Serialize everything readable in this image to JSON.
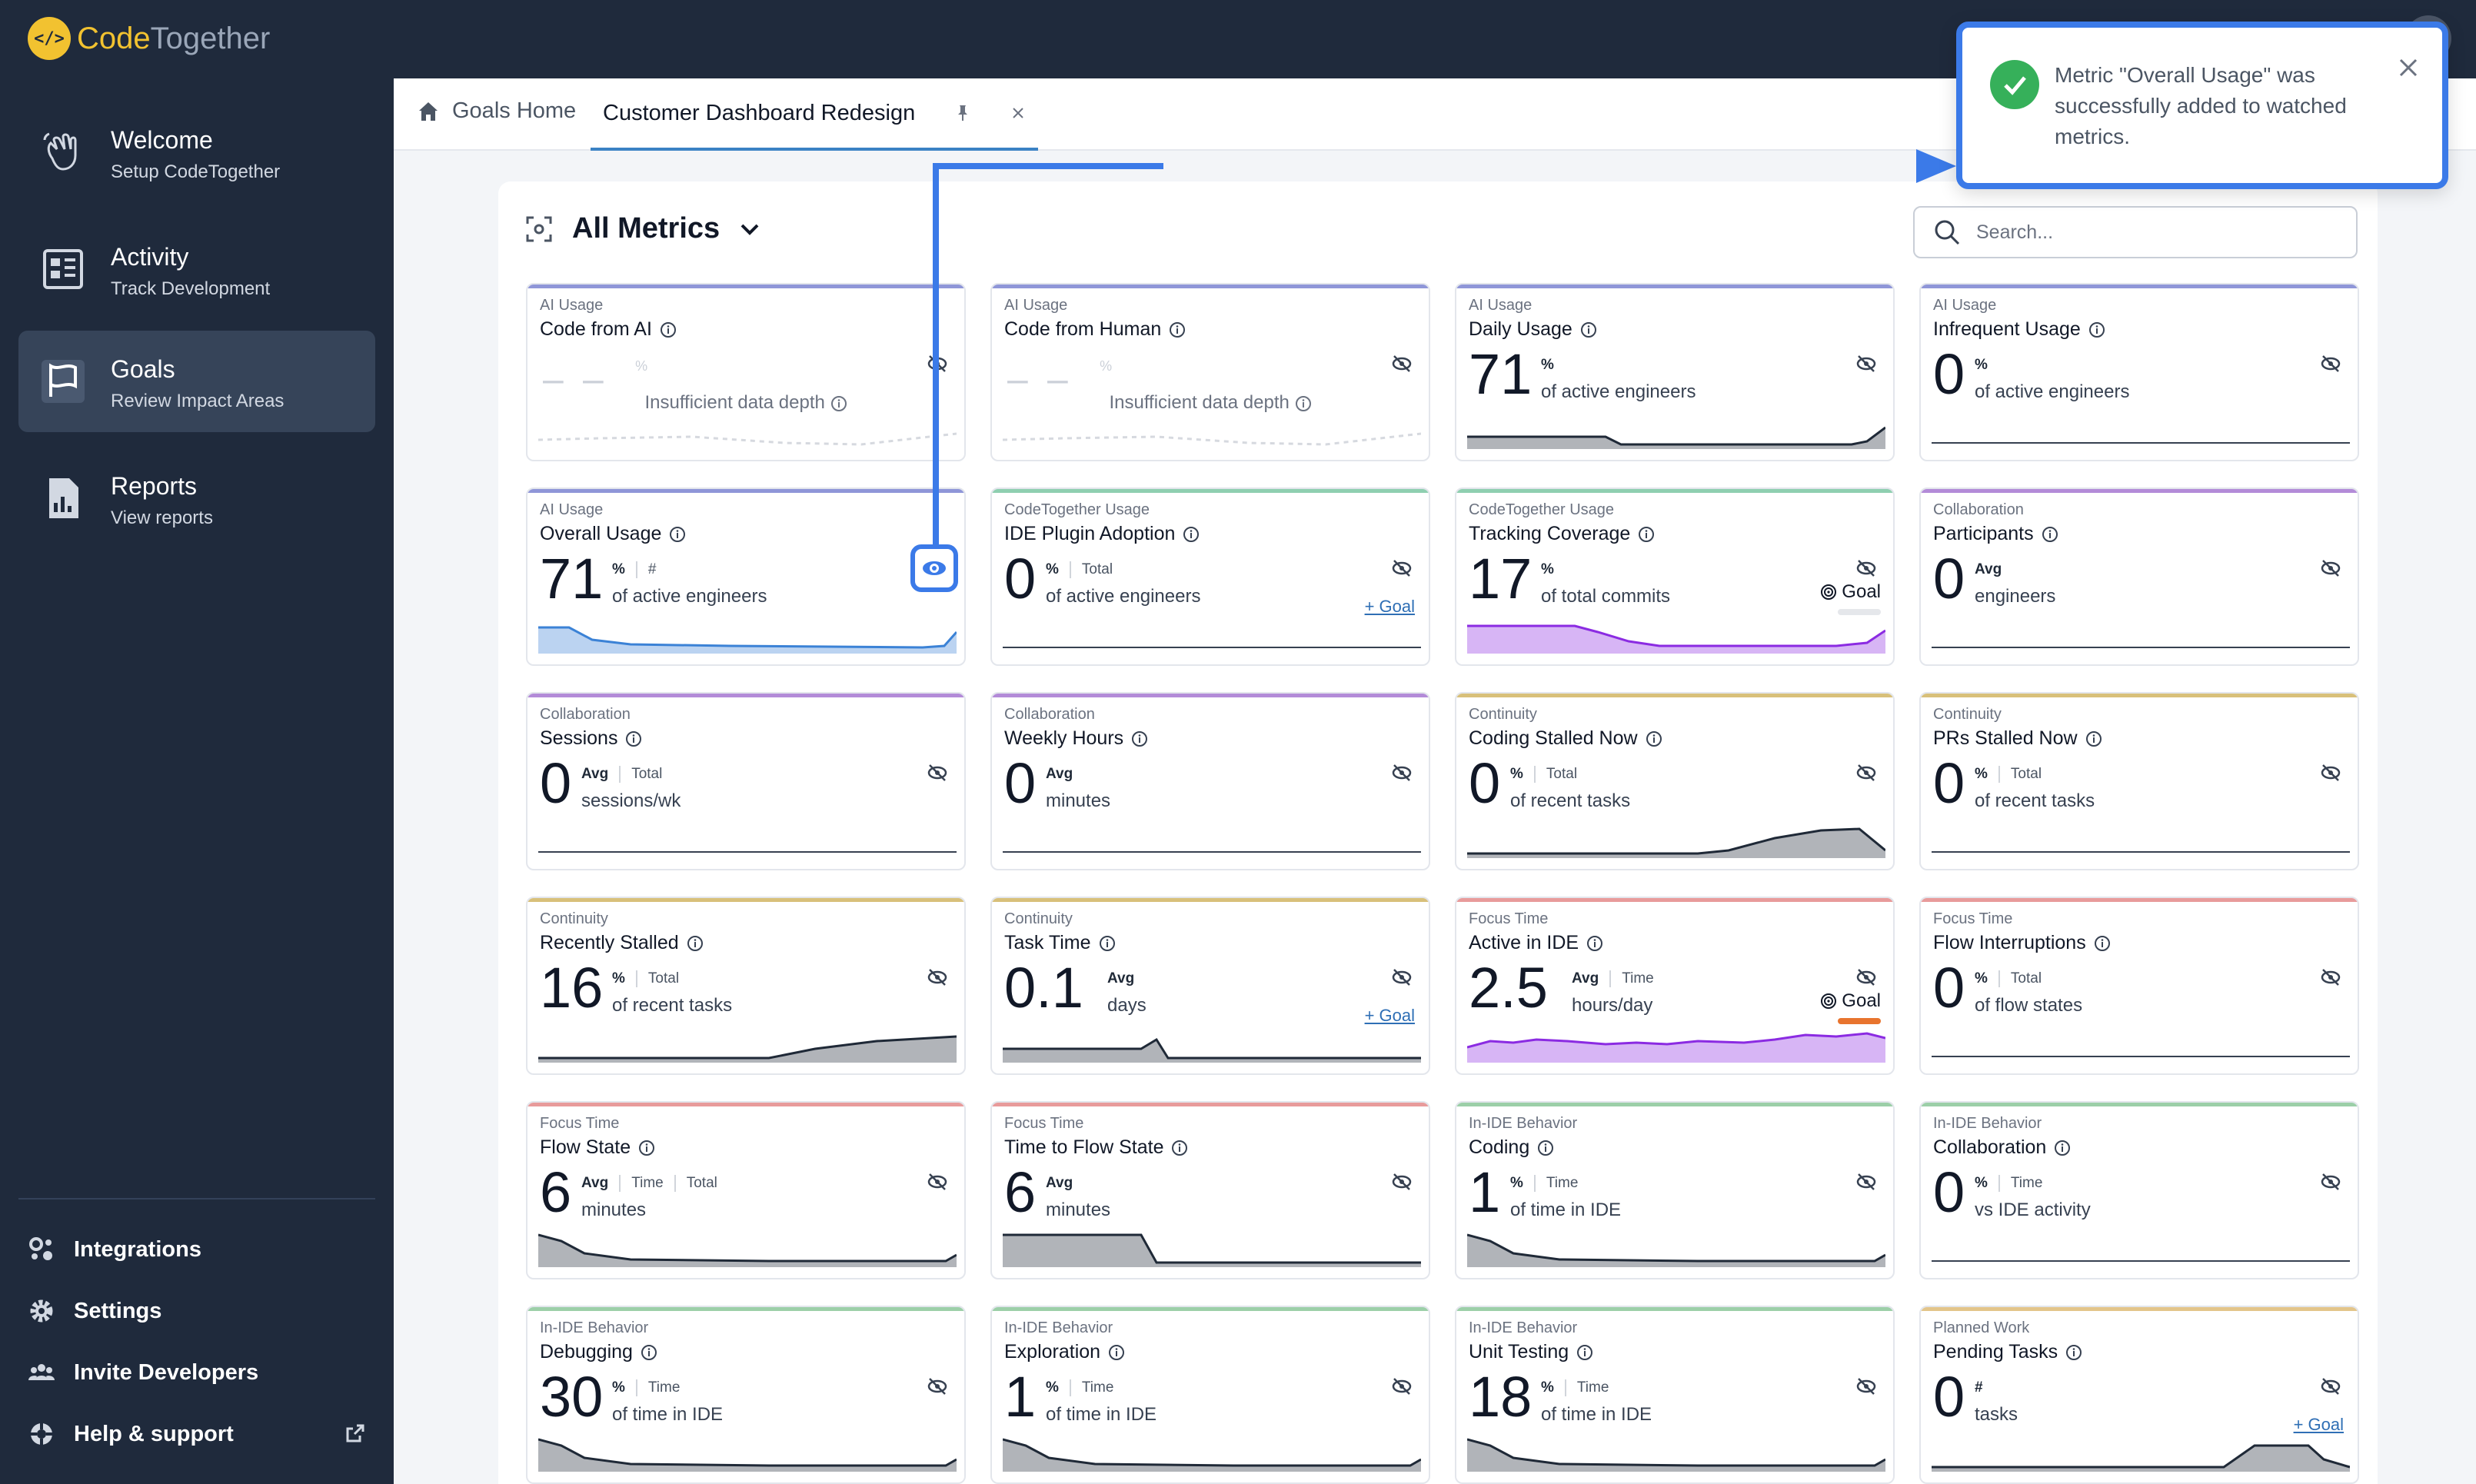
{
  "app": {
    "logo_left": "Code",
    "logo_right": "Together",
    "logo_mark": "</>"
  },
  "sidebar": {
    "items": [
      {
        "title": "Welcome",
        "sub": "Setup CodeTogether",
        "icon": "hand-wave-icon"
      },
      {
        "title": "Activity",
        "sub": "Track Development",
        "icon": "activity-icon"
      },
      {
        "title": "Goals",
        "sub": "Review Impact Areas",
        "icon": "flag-icon"
      },
      {
        "title": "Reports",
        "sub": "View reports",
        "icon": "report-icon"
      }
    ],
    "bottom": [
      {
        "label": "Integrations",
        "icon": "integrations-icon"
      },
      {
        "label": "Settings",
        "icon": "gear-icon"
      },
      {
        "label": "Invite Developers",
        "icon": "users-icon"
      },
      {
        "label": "Help & support",
        "icon": "help-icon"
      }
    ]
  },
  "tabs": {
    "home": "Goals Home",
    "active": "Customer Dashboard Redesign"
  },
  "main": {
    "title": "All Metrics",
    "search_placeholder": "Search..."
  },
  "toast": {
    "message": "Metric \"Overall Usage\" was successfully added to watched metrics."
  },
  "colors": {
    "ai": "#8f96d8",
    "ct": "#8fcfb0",
    "collab": "#b38bd8",
    "continuity": "#d8c07a",
    "focus": "#e89b9b",
    "ide": "#9ccfa8",
    "planned": "#e3c58a",
    "accent": "#3b7ae8"
  },
  "cards": [
    {
      "cat": "AI Usage",
      "name": "Code from AI",
      "state": "insufficient",
      "note": "Insufficient data depth",
      "units": [
        "%"
      ],
      "color": "ai"
    },
    {
      "cat": "AI Usage",
      "name": "Code from Human",
      "state": "insufficient",
      "note": "Insufficient data depth",
      "units": [
        "%"
      ],
      "color": "ai"
    },
    {
      "cat": "AI Usage",
      "name": "Daily Usage",
      "value": "71",
      "units": [
        "%"
      ],
      "desc": "of active engineers",
      "color": "ai",
      "spark": "tail"
    },
    {
      "cat": "AI Usage",
      "name": "Infrequent Usage",
      "value": "0",
      "units": [
        "%"
      ],
      "desc": "of active engineers",
      "color": "ai",
      "spark": "flat"
    },
    {
      "cat": "AI Usage",
      "name": "Overall Usage",
      "value": "71",
      "units": [
        "%",
        "#"
      ],
      "desc": "of active engineers",
      "color": "ai",
      "spark": "blue",
      "watched": true
    },
    {
      "cat": "CodeTogether Usage",
      "name": "IDE Plugin Adoption",
      "value": "0",
      "units": [
        "%",
        "Total"
      ],
      "desc": "of active engineers",
      "color": "ct",
      "spark": "flat",
      "goal_btn": "+ Goal"
    },
    {
      "cat": "CodeTogether Usage",
      "name": "Tracking Coverage",
      "value": "17",
      "units": [
        "%"
      ],
      "desc": "of total commits",
      "color": "ct",
      "spark": "purple",
      "goal_tag": "Goal",
      "goal_color": "#e5e7eb"
    },
    {
      "cat": "Collaboration",
      "name": "Participants",
      "value": "0",
      "units": [
        "Avg"
      ],
      "desc": "engineers",
      "color": "collab",
      "spark": "flat"
    },
    {
      "cat": "Collaboration",
      "name": "Sessions",
      "value": "0",
      "units": [
        "Avg",
        "Total"
      ],
      "desc": "sessions/wk",
      "color": "collab",
      "spark": "flat"
    },
    {
      "cat": "Collaboration",
      "name": "Weekly Hours",
      "value": "0",
      "units": [
        "Avg"
      ],
      "desc": "minutes",
      "color": "collab",
      "spark": "flat"
    },
    {
      "cat": "Continuity",
      "name": "Coding Stalled Now",
      "value": "0",
      "units": [
        "%",
        "Total"
      ],
      "desc": "of recent tasks",
      "color": "continuity",
      "spark": "hump"
    },
    {
      "cat": "Continuity",
      "name": "PRs Stalled Now",
      "value": "0",
      "units": [
        "%",
        "Total"
      ],
      "desc": "of recent tasks",
      "color": "continuity",
      "spark": "flat"
    },
    {
      "cat": "Continuity",
      "name": "Recently Stalled",
      "value": "16",
      "units": [
        "%",
        "Total"
      ],
      "desc": "of recent tasks",
      "color": "continuity",
      "spark": "rise"
    },
    {
      "cat": "Continuity",
      "name": "Task Time",
      "value": "0.1",
      "units": [
        "Avg"
      ],
      "desc": "days",
      "color": "continuity",
      "spark": "step",
      "goal_btn": "+ Goal"
    },
    {
      "cat": "Focus Time",
      "name": "Active in IDE",
      "value": "2.5",
      "units": [
        "Avg",
        "Time"
      ],
      "desc": "hours/day",
      "color": "focus",
      "spark": "purplewave",
      "goal_tag": "Goal",
      "goal_color": "#e8742e"
    },
    {
      "cat": "Focus Time",
      "name": "Flow Interruptions",
      "value": "0",
      "units": [
        "%",
        "Total"
      ],
      "desc": "of flow states",
      "color": "focus",
      "spark": "flat"
    },
    {
      "cat": "Focus Time",
      "name": "Flow State",
      "value": "6",
      "units": [
        "Avg",
        "Time",
        "Total"
      ],
      "desc": "minutes",
      "color": "focus",
      "spark": "decay"
    },
    {
      "cat": "Focus Time",
      "name": "Time to Flow State",
      "value": "6",
      "units": [
        "Avg"
      ],
      "desc": "minutes",
      "color": "focus",
      "spark": "block"
    },
    {
      "cat": "In-IDE Behavior",
      "name": "Coding",
      "value": "1",
      "units": [
        "%",
        "Time"
      ],
      "desc": "of time in IDE",
      "color": "ide",
      "spark": "decay"
    },
    {
      "cat": "In-IDE Behavior",
      "name": "Collaboration",
      "value": "0",
      "units": [
        "%",
        "Time"
      ],
      "desc": "vs IDE activity",
      "color": "ide",
      "spark": "flat"
    },
    {
      "cat": "In-IDE Behavior",
      "name": "Debugging",
      "value": "30",
      "units": [
        "%",
        "Time"
      ],
      "desc": "of time in IDE",
      "color": "ide",
      "spark": "decay"
    },
    {
      "cat": "In-IDE Behavior",
      "name": "Exploration",
      "value": "1",
      "units": [
        "%",
        "Time"
      ],
      "desc": "of time in IDE",
      "color": "ide",
      "spark": "decay"
    },
    {
      "cat": "In-IDE Behavior",
      "name": "Unit Testing",
      "value": "18",
      "units": [
        "%",
        "Time"
      ],
      "desc": "of time in IDE",
      "color": "ide",
      "spark": "decay"
    },
    {
      "cat": "Planned Work",
      "name": "Pending Tasks",
      "value": "0",
      "units": [
        "#"
      ],
      "desc": "tasks",
      "color": "planned",
      "spark": "bump",
      "goal_btn": "+ Goal"
    }
  ]
}
